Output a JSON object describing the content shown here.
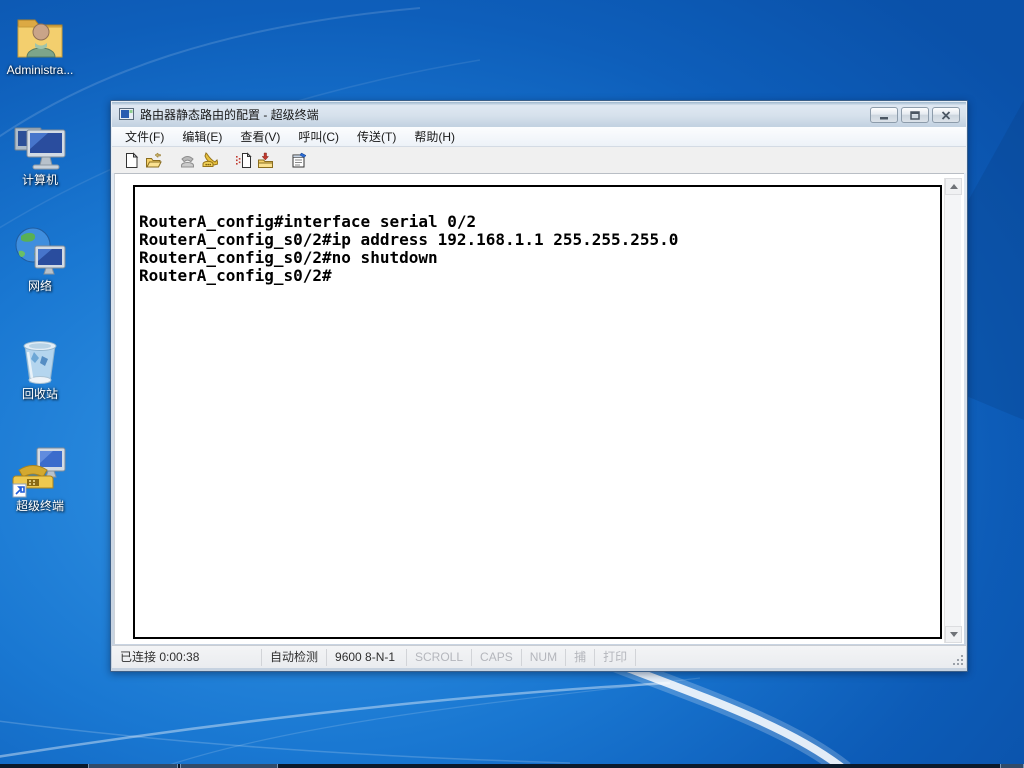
{
  "colors": {
    "wallpaper_blue": "#1373cf",
    "titlebar_gradient_top": "#dfe8f2",
    "titlebar_gradient_bottom": "#c2d1e1",
    "terminal_background": "#ffffff",
    "terminal_text": "#000000",
    "status_disabled_text": "#b4b6bc",
    "folder_yellow": "#f3cf6e",
    "phone_yellow": "#eec94f"
  },
  "desktop": {
    "icons": [
      {
        "id": "administrator",
        "label": "Administra..."
      },
      {
        "id": "computer",
        "label": "计算机"
      },
      {
        "id": "network",
        "label": "网络"
      },
      {
        "id": "recycle-bin",
        "label": "回收站"
      },
      {
        "id": "hyperterminal",
        "label": "超级终端"
      }
    ]
  },
  "window": {
    "title": "路由器静态路由的配置 - 超级终端",
    "controls": [
      {
        "name": "minimize"
      },
      {
        "name": "maximize"
      },
      {
        "name": "close"
      }
    ],
    "menus": [
      "文件(F)",
      "编辑(E)",
      "查看(V)",
      "呼叫(C)",
      "传送(T)",
      "帮助(H)"
    ],
    "toolbar_icons": [
      "new-connection",
      "open",
      "call",
      "disconnect",
      "send",
      "receive",
      "properties"
    ],
    "terminal": {
      "lines": [
        "RouterA_config#interface serial 0/2",
        "RouterA_config_s0/2#ip address 192.168.1.1 255.255.255.0",
        "RouterA_config_s0/2#no shutdown",
        "RouterA_config_s0/2#"
      ]
    },
    "statusbar": [
      {
        "label": "已连接 0:00:38",
        "enabled": true
      },
      {
        "label": "自动检测",
        "enabled": true
      },
      {
        "label": "9600 8-N-1",
        "enabled": true
      },
      {
        "label": "SCROLL",
        "enabled": false
      },
      {
        "label": "CAPS",
        "enabled": false
      },
      {
        "label": "NUM",
        "enabled": false
      },
      {
        "label": "捕",
        "enabled": false
      },
      {
        "label": "打印",
        "enabled": false
      }
    ]
  }
}
